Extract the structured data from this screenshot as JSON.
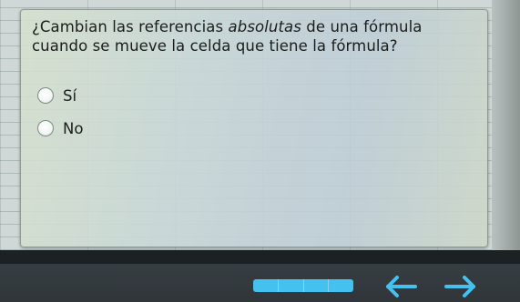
{
  "quiz": {
    "question_before": "¿Cambian las referencias ",
    "question_emphasis": "absolutas",
    "question_after": " de una fórmula cuando se mueve la celda que tiene la fórmula?",
    "options": [
      {
        "label": "Sí",
        "selected": false
      },
      {
        "label": "No",
        "selected": false
      }
    ]
  },
  "toolbar": {
    "progress_segments": 4,
    "accent_color": "#45c1f0",
    "prev_icon": "arrow-left-icon",
    "next_icon": "arrow-right-icon"
  }
}
